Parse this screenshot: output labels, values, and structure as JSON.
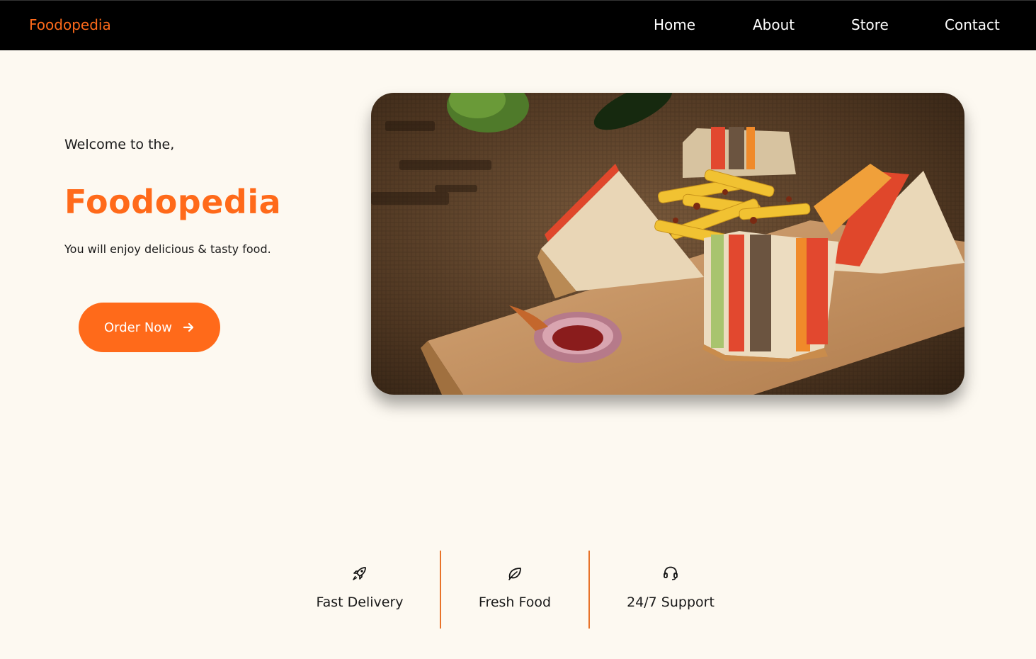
{
  "nav": {
    "brand": "Foodopedia",
    "links": [
      "Home",
      "About",
      "Store",
      "Contact"
    ]
  },
  "hero": {
    "welcome": "Welcome to the,",
    "title": "Foodopedia",
    "tagline": "You will enjoy delicious & tasty food.",
    "cta_label": "Order Now",
    "cta_icon": "arrow-right-icon"
  },
  "features": [
    {
      "label": "Fast Delivery",
      "icon": "rocket-icon"
    },
    {
      "label": "Fresh Food",
      "icon": "leaf-icon"
    },
    {
      "label": "24/7 Support",
      "icon": "headset-icon"
    }
  ],
  "colors": {
    "accent": "#ff6a1a",
    "background": "#fdf9f1",
    "navbar": "#000000",
    "divider": "#e8732a"
  }
}
